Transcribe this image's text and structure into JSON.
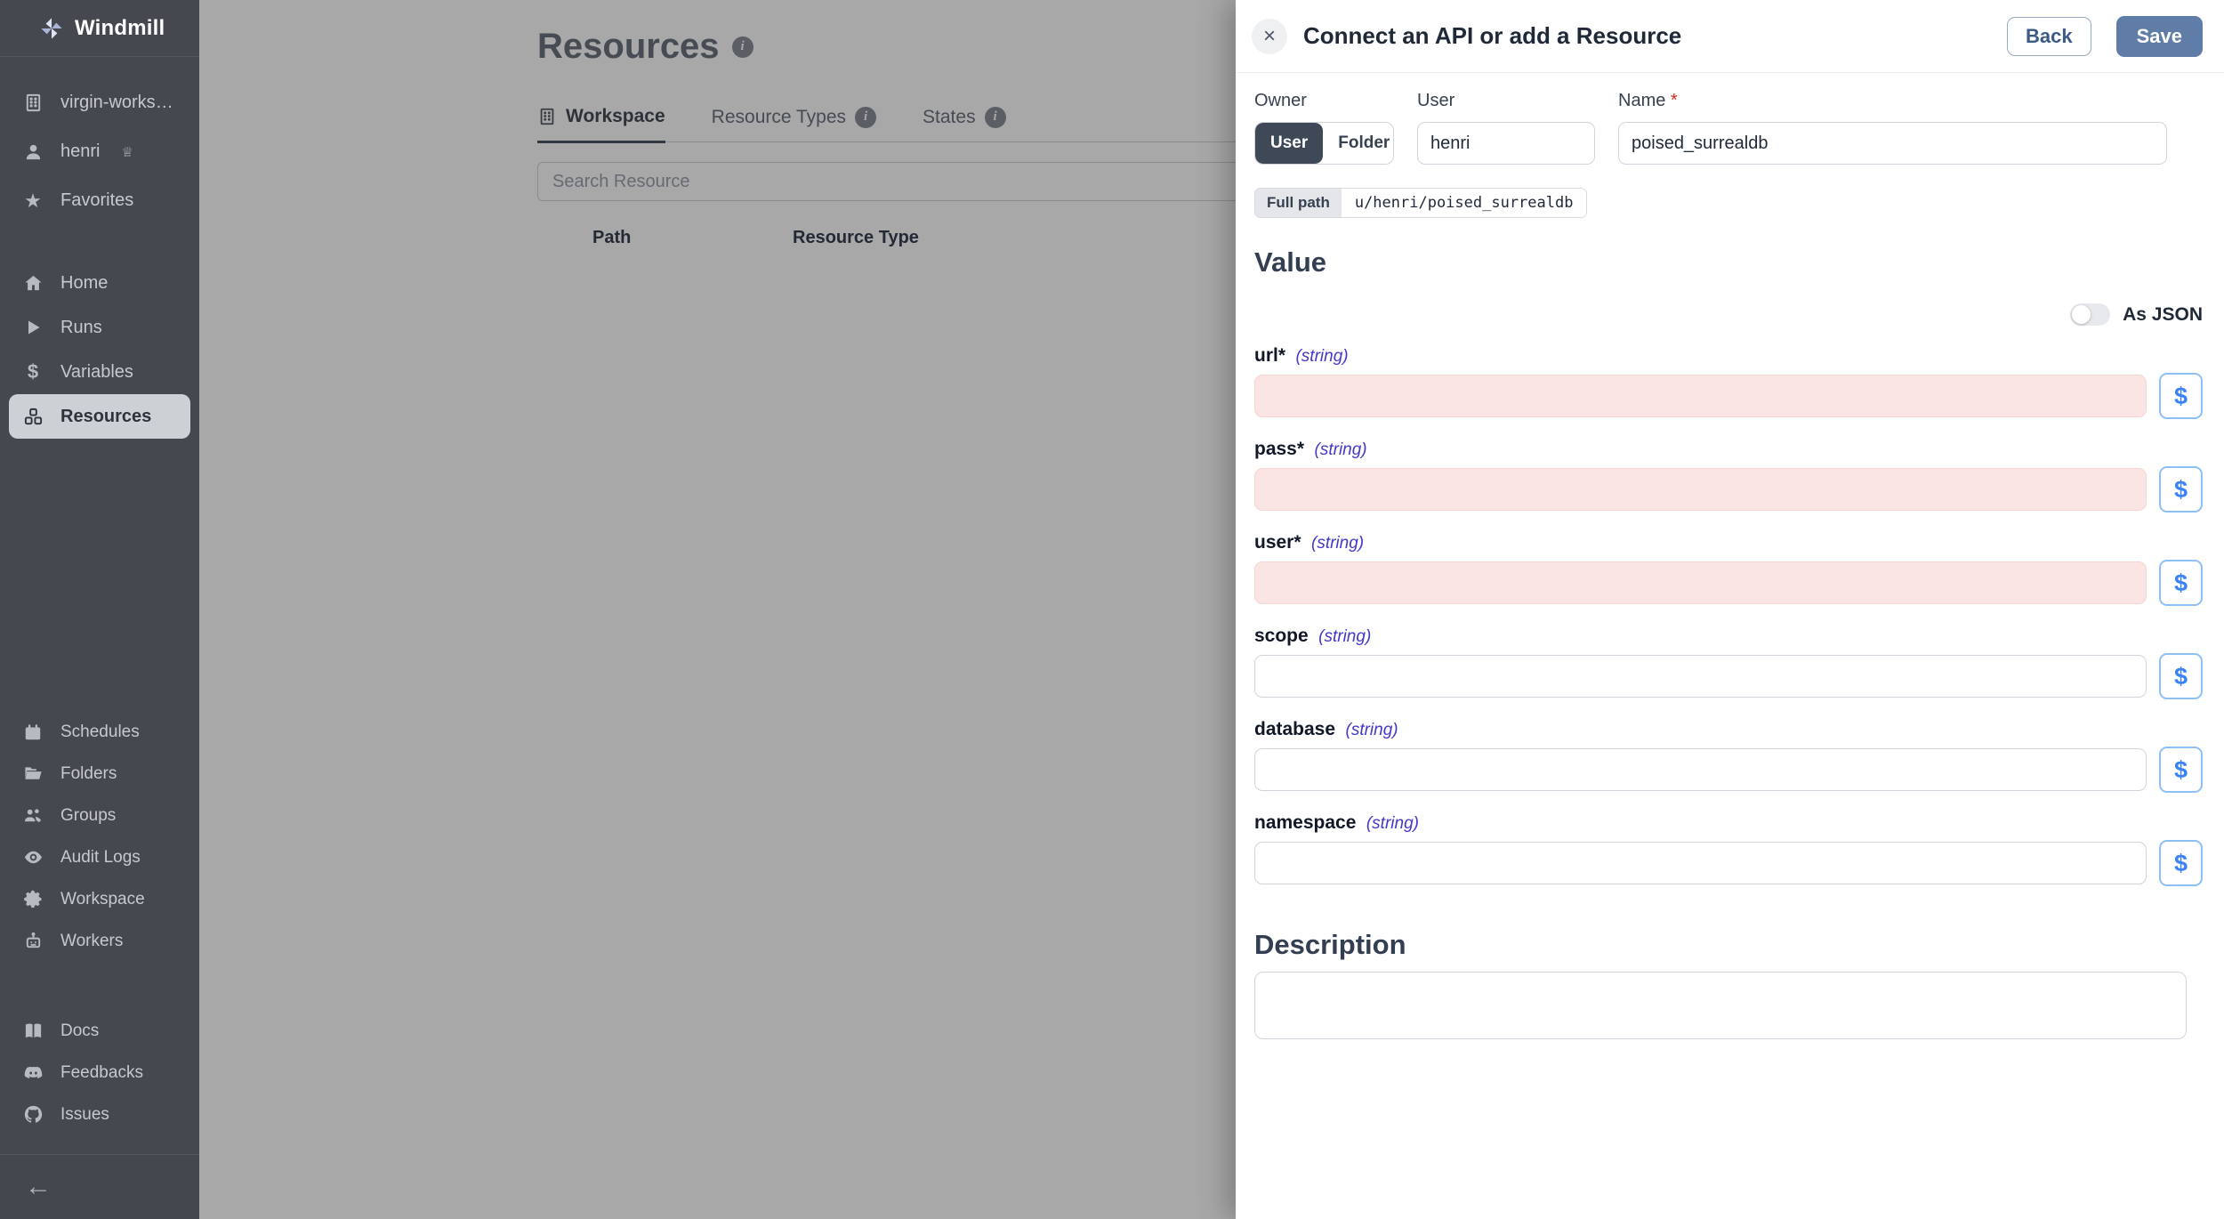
{
  "sidebar": {
    "logo_text": "Windmill",
    "top": {
      "workspace": "virgin-worksp...",
      "user": "henri",
      "favorites": "Favorites"
    },
    "nav": [
      {
        "label": "Home"
      },
      {
        "label": "Runs"
      },
      {
        "label": "Variables"
      },
      {
        "label": "Resources",
        "active": true
      }
    ],
    "admin": [
      {
        "label": "Schedules"
      },
      {
        "label": "Folders"
      },
      {
        "label": "Groups"
      },
      {
        "label": "Audit Logs"
      },
      {
        "label": "Workspace"
      },
      {
        "label": "Workers"
      }
    ],
    "links": [
      {
        "label": "Docs"
      },
      {
        "label": "Feedbacks"
      },
      {
        "label": "Issues"
      }
    ]
  },
  "main": {
    "title": "Resources",
    "tabs": [
      {
        "label": "Workspace",
        "active": true
      },
      {
        "label": "Resource Types"
      },
      {
        "label": "States"
      }
    ],
    "search_placeholder": "Search Resource",
    "table": {
      "columns": [
        "Path",
        "Resource Type"
      ]
    }
  },
  "drawer": {
    "title": "Connect an API or add a Resource",
    "close_label": "×",
    "back_label": "Back",
    "save_label": "Save",
    "owner": {
      "label": "Owner",
      "option_user": "User",
      "option_folder": "Folder",
      "selected": "User"
    },
    "user_field": {
      "label": "User",
      "value": "henri"
    },
    "name_field": {
      "label": "Name",
      "required": "*",
      "value": "poised_surrealdb"
    },
    "full_path": {
      "label": "Full path",
      "value": "u/henri/poised_surrealdb"
    },
    "value_section": {
      "heading": "Value",
      "as_json_label": "As JSON",
      "as_json_on": false
    },
    "dollar_label": "$",
    "fields": [
      {
        "name": "url",
        "required": "*",
        "type": "(string)",
        "value": "",
        "invalid": true
      },
      {
        "name": "pass",
        "required": "*",
        "type": "(string)",
        "value": "",
        "invalid": true
      },
      {
        "name": "user",
        "required": "*",
        "type": "(string)",
        "value": "",
        "invalid": true
      },
      {
        "name": "scope",
        "type": "(string)",
        "value": ""
      },
      {
        "name": "database",
        "type": "(string)",
        "value": ""
      },
      {
        "name": "namespace",
        "type": "(string)",
        "value": ""
      }
    ],
    "description": {
      "heading": "Description",
      "value": ""
    }
  },
  "colors": {
    "sidebar_bg": "#45484f",
    "sidebar_active_pill": "#cdd0d4",
    "save_button": "#5f7da6",
    "back_button_text": "#3b5a85",
    "required_star": "#dc2626",
    "type_hint": "#4338ca",
    "invalid_field_bg": "#fbe5e4",
    "dollar_button": "#3b82f6",
    "overlay": "rgba(0,0,0,0.34)"
  }
}
